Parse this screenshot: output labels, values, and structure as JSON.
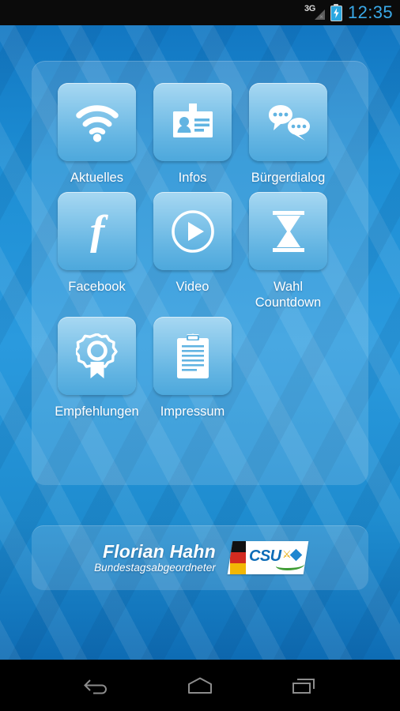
{
  "status_bar": {
    "network_label": "3G",
    "network_icon": "signal-triangle-icon",
    "battery_icon": "battery-charging-icon",
    "time": "12:35",
    "time_color": "#3aa9e8"
  },
  "theme": {
    "background_top": "#1277c2",
    "background_mid": "#2a9ade",
    "background_bottom": "#0e6cb4",
    "tile_light": "#a8d8f2",
    "tile_dark": "#4da8dc",
    "label_color": "#ffffff",
    "panel_fill": "rgba(255,255,255,0.14)"
  },
  "menu": {
    "items": [
      {
        "label": "Aktuelles",
        "icon": "wifi-rss-icon"
      },
      {
        "label": "Infos",
        "icon": "id-badge-icon"
      },
      {
        "label": "Bürgerdialog",
        "icon": "speech-bubbles-icon"
      },
      {
        "label": "Facebook",
        "icon": "facebook-f-icon"
      },
      {
        "label": "Video",
        "icon": "play-circle-icon"
      },
      {
        "label": "Wahl\nCountdown",
        "icon": "hourglass-icon"
      },
      {
        "label": "Empfehlungen",
        "icon": "award-rosette-icon"
      },
      {
        "label": "Impressum",
        "icon": "clipboard-icon"
      }
    ]
  },
  "footer": {
    "name": "Florian Hahn",
    "role": "Bundestagsabgeordneter",
    "logo": {
      "name": "csu-logo",
      "text": "CSU",
      "lion_icon": "bavarian-lion-icon",
      "diamond_icon": "blue-diamond-icon",
      "swoosh_icon": "green-swoosh-icon",
      "flag_colors": [
        "#111111",
        "#d32b20",
        "#f2b705"
      ],
      "text_color": "#0d6cb7"
    }
  },
  "nav_bar": {
    "buttons": [
      {
        "name": "back-button",
        "icon": "back-arrow-icon"
      },
      {
        "name": "home-button",
        "icon": "home-icon"
      },
      {
        "name": "recents-button",
        "icon": "recents-icon"
      }
    ]
  }
}
